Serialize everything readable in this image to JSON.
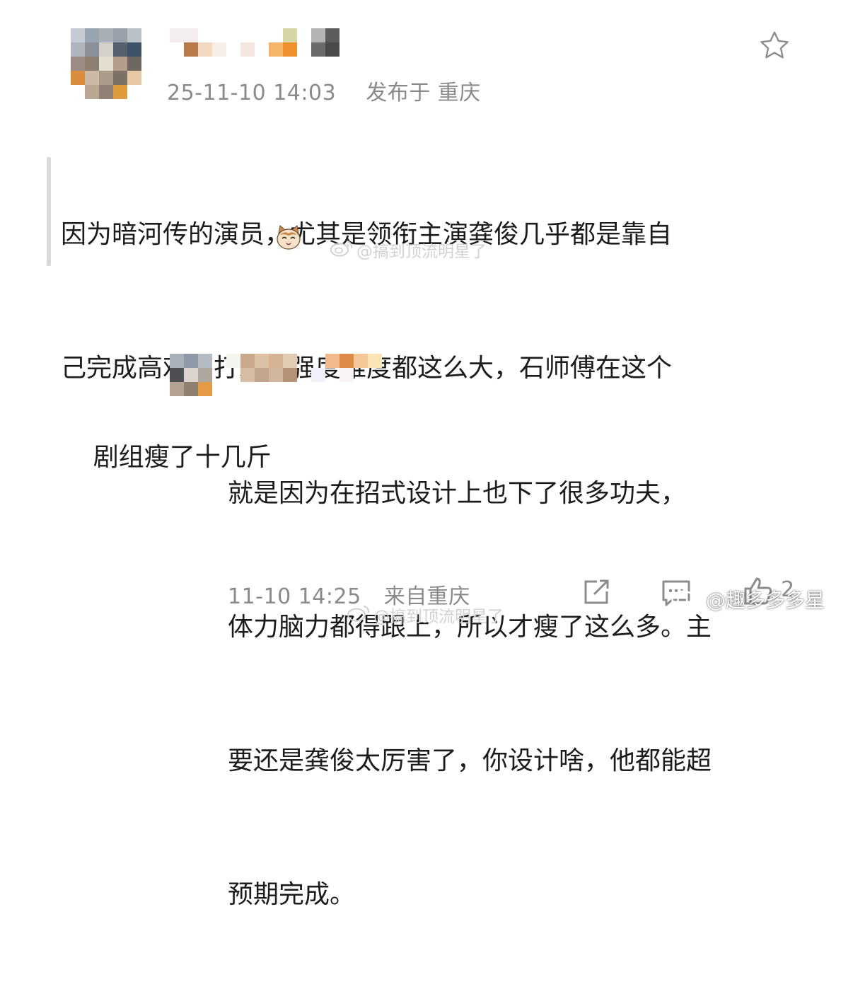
{
  "comment": {
    "timestamp": "25-11-10 14:03",
    "location": "发布于 重庆",
    "text_lines": [
      "因为暗河传的演员，尤其是领衔主演龚俊几乎都是靠自",
      "己完成高难度打戏，强度难度都这么大，石师傅在这个",
      "剧组瘦了十几斤"
    ],
    "watermark": "@搞到顶流明星了"
  },
  "reply": {
    "text_lines": [
      "就是因为在招式设计上也下了很多功夫，",
      "体力脑力都得跟上，所以才瘦了这么多。主",
      "要还是龚俊太厉害了，你设计啥，他都能超",
      "预期完成。"
    ],
    "timestamp": "11-10 14:25",
    "location": "来自重庆",
    "count_partial": "2",
    "watermark_bottom": "@搞到顶流明星了"
  },
  "corner_watermark": "@趣多多多星",
  "icons": {
    "favorite": "star-outline-icon",
    "share": "share-icon",
    "comment": "comment-icon",
    "like": "like-icon",
    "weibo": "weibo-logo-icon",
    "emoji": "cat-emoji-icon"
  },
  "colors": {
    "meta_gray": "#8a8a8a",
    "text": "#1c1c1c",
    "quote_bar": "#d9d9d9"
  }
}
